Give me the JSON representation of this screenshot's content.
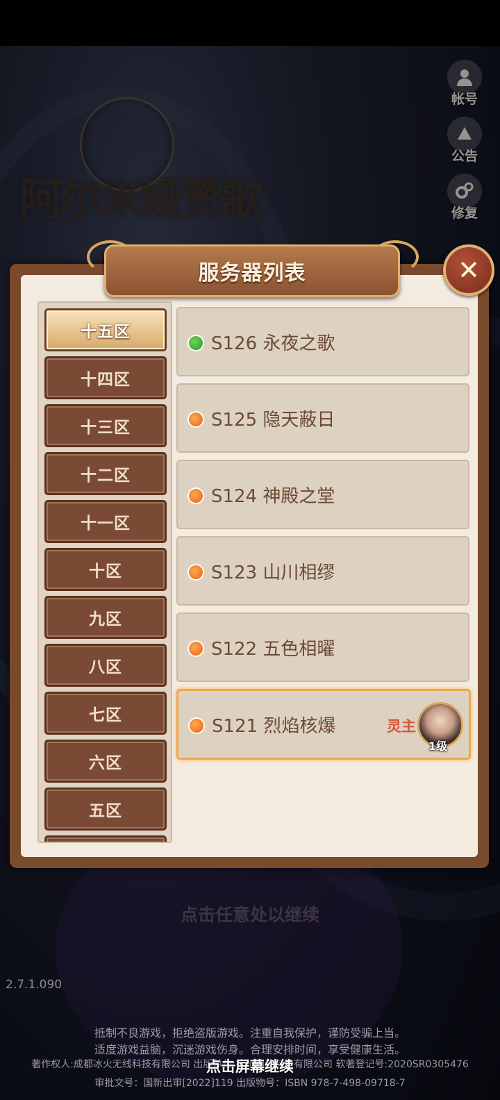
{
  "game": {
    "logo_text": "阿尔米娅赞歌"
  },
  "side_menu": [
    {
      "label": "帐号",
      "icon": "account-icon"
    },
    {
      "label": "公告",
      "icon": "announcement-icon"
    },
    {
      "label": "修复",
      "icon": "repair-icon"
    }
  ],
  "dialog": {
    "title": "服务器列表",
    "close_icon": "close-icon"
  },
  "zones": [
    {
      "label": "十五区",
      "active": true
    },
    {
      "label": "十四区",
      "active": false
    },
    {
      "label": "十三区",
      "active": false
    },
    {
      "label": "十二区",
      "active": false
    },
    {
      "label": "十一区",
      "active": false
    },
    {
      "label": "十区",
      "active": false
    },
    {
      "label": "九区",
      "active": false
    },
    {
      "label": "八区",
      "active": false
    },
    {
      "label": "七区",
      "active": false
    },
    {
      "label": "六区",
      "active": false
    },
    {
      "label": "五区",
      "active": false
    }
  ],
  "servers": [
    {
      "name": "S126 永夜之歌",
      "status": "green"
    },
    {
      "name": "S125 隐天蔽日",
      "status": "orange"
    },
    {
      "name": "S124 神殿之堂",
      "status": "orange"
    },
    {
      "name": "S123 山川相缪",
      "status": "orange"
    },
    {
      "name": "S122 五色相曜",
      "status": "orange"
    },
    {
      "name": "S121 烈焰核爆",
      "status": "orange",
      "role_label": "灵主",
      "level_label": "1级",
      "selected": true
    }
  ],
  "footer": {
    "tap_anywhere": "点击任意处以继续",
    "version": "2.7.1.090",
    "legal_line1": "抵制不良游戏，拒绝盗版游戏。注重自我保护，谨防受骗上当。",
    "legal_line2": "适度游戏益脑，沉迷游戏伤身。合理安排时间，享受健康生活。",
    "legal_line3": "著作权人:成都冰火无线科技有限公司 出版单位:杭州润趣科技有限公司 软著登记号:2020SR0305476",
    "legal_line4": "审批文号：国新出审[2022]119   出版物号：ISBN 978-7-498-09718-7",
    "continue": "点击屏幕继续"
  },
  "colors": {
    "status_green": "#2a9a1e",
    "status_orange": "#e8600e",
    "panel_brown": "#7a4a2d",
    "selected_border": "#f0a84a",
    "role_text": "#d05a3a"
  }
}
